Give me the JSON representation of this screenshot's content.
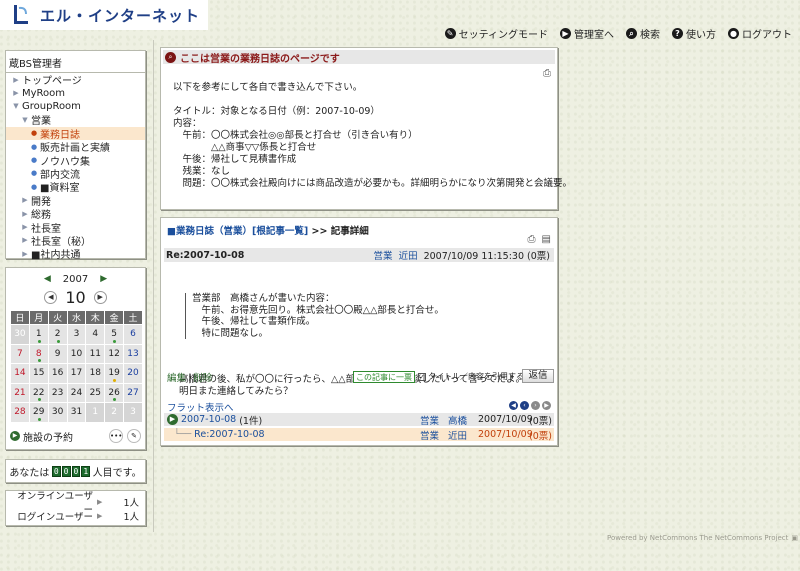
{
  "logo": {
    "text": "エル・インターネット"
  },
  "header_nav": [
    {
      "icon": "setting-icon",
      "glyph": "✎",
      "label": "セッティングモード"
    },
    {
      "icon": "arrow-right-icon",
      "glyph": "▶",
      "label": "管理室へ"
    },
    {
      "icon": "search-icon",
      "glyph": "⌕",
      "label": "検索"
    },
    {
      "icon": "help-icon",
      "glyph": "?",
      "label": "使い方"
    },
    {
      "icon": "user-icon",
      "glyph": "●",
      "label": "ログアウト"
    }
  ],
  "tree": {
    "title": "蔵BS管理者",
    "items": [
      {
        "label": "トップページ",
        "type": "arrow",
        "indent": 0
      },
      {
        "label": "MyRoom",
        "type": "arrow",
        "indent": 0
      },
      {
        "label": "GroupRoom",
        "type": "open",
        "indent": 0
      },
      {
        "label": "営業",
        "type": "open",
        "indent": 1
      },
      {
        "label": "業務日誌",
        "type": "dot",
        "indent": 2,
        "selected": true
      },
      {
        "label": "販売計画と実績",
        "type": "dot",
        "indent": 2
      },
      {
        "label": "ノウハウ集",
        "type": "dot",
        "indent": 2
      },
      {
        "label": "部内交流",
        "type": "dot",
        "indent": 2
      },
      {
        "label": "■資料室",
        "type": "dot",
        "indent": 2
      },
      {
        "label": "開発",
        "type": "arrow",
        "indent": 1
      },
      {
        "label": "総務",
        "type": "arrow",
        "indent": 1
      },
      {
        "label": "社長室",
        "type": "arrow",
        "indent": 1
      },
      {
        "label": "社長室（秘）",
        "type": "arrow",
        "indent": 1
      },
      {
        "label": "■社内共通",
        "type": "arrow",
        "indent": 1
      }
    ]
  },
  "calendar": {
    "year": "2007",
    "month": "10",
    "weekdays": [
      "日",
      "月",
      "火",
      "水",
      "木",
      "金",
      "土"
    ],
    "weeks": [
      [
        {
          "d": "30",
          "o": true
        },
        {
          "d": "1",
          "m": "#3a9a3a"
        },
        {
          "d": "2",
          "m": "#3a9a3a"
        },
        {
          "d": "3"
        },
        {
          "d": "4"
        },
        {
          "d": "5",
          "m": "#3a9a3a"
        },
        {
          "d": "6"
        }
      ],
      [
        {
          "d": "7"
        },
        {
          "d": "8",
          "m": "#3a9a3a",
          "h": true
        },
        {
          "d": "9"
        },
        {
          "d": "10"
        },
        {
          "d": "11"
        },
        {
          "d": "12"
        },
        {
          "d": "13"
        }
      ],
      [
        {
          "d": "14"
        },
        {
          "d": "15"
        },
        {
          "d": "16"
        },
        {
          "d": "17"
        },
        {
          "d": "18"
        },
        {
          "d": "19",
          "m": "#e0b000"
        },
        {
          "d": "20"
        }
      ],
      [
        {
          "d": "21"
        },
        {
          "d": "22",
          "m": "#3a9a3a"
        },
        {
          "d": "23"
        },
        {
          "d": "24"
        },
        {
          "d": "25"
        },
        {
          "d": "26",
          "m": "#3a9a3a"
        },
        {
          "d": "27"
        }
      ],
      [
        {
          "d": "28"
        },
        {
          "d": "29",
          "m": "#3a9a3a"
        },
        {
          "d": "30"
        },
        {
          "d": "31"
        },
        {
          "d": "1",
          "o": true
        },
        {
          "d": "2",
          "o": true
        },
        {
          "d": "3",
          "o": true
        }
      ]
    ],
    "facility_link": "施設の予約"
  },
  "counter": {
    "prefix": "あなたは",
    "digits": [
      "0",
      "0",
      "0",
      "1"
    ],
    "suffix": "人目です。"
  },
  "online": [
    {
      "label": "オンラインユーザー",
      "value": "1人"
    },
    {
      "label": "ログインユーザー",
      "value": "1人"
    }
  ],
  "notice": {
    "title": "ここは営業の業務日誌のページです",
    "body": "以下を参考にして各自で書き込んで下さい。\n\nタイトル：対象となる日付（例：2007-10-09）\n内容：\n　午前：〇〇株式会社◎◎部長と打合せ（引き合い有り）\n　　　　△△商事▽▽係長と打合せ\n　午後：帰社して見積書作成\n　残業：なし\n　問題：〇〇株式会社殿向けには商品改造が必要かも。詳細明らかになり次第開発と会議要。"
  },
  "detail": {
    "crumb_blog": "■業務日誌（営業）",
    "crumb_list": "[根記事一覧]",
    "crumb_sep": ">>",
    "crumb_current": "記事詳細",
    "post_title": "Re:2007-10-08",
    "post_group": "営業",
    "post_user": "近田",
    "post_date": "2007/10/09 11:15:30 (0票)",
    "quote": "営業部　高橋さんが書いた内容：\n　午前、お得意先回り。株式会社〇〇殿△△部長と打合せ。\n　午後、帰社して書類作成。\n　特に問題なし。",
    "body": "高橋君の後、私が〇〇に行ったら、△△部長が、何か相談したいって言ってたよ。\n明日また連絡してみたら？",
    "edit": "編集",
    "delete": "削除",
    "recommend": "この記事に一票",
    "quote_check": "タイトル／内容を引用する",
    "reply": "返信",
    "flat_label": "フラット表示へ",
    "threads": [
      {
        "title": "2007-10-08",
        "count": "(1件)",
        "group": "営業",
        "user": "高橋",
        "date": "2007/10/09",
        "votes": "(0票)"
      },
      {
        "title": "Re:2007-10-08",
        "count": "",
        "group": "営業",
        "user": "近田",
        "date": "2007/10/09",
        "votes": "(0票)"
      }
    ]
  },
  "footer": {
    "text": "Powered by NetCommons  The NetCommons Project"
  },
  "colors": {
    "accent": "#1f3f86",
    "selected_bg": "#fbe7cd",
    "selected_text": "#c2410c",
    "notice_title": "#8b1a1a"
  }
}
